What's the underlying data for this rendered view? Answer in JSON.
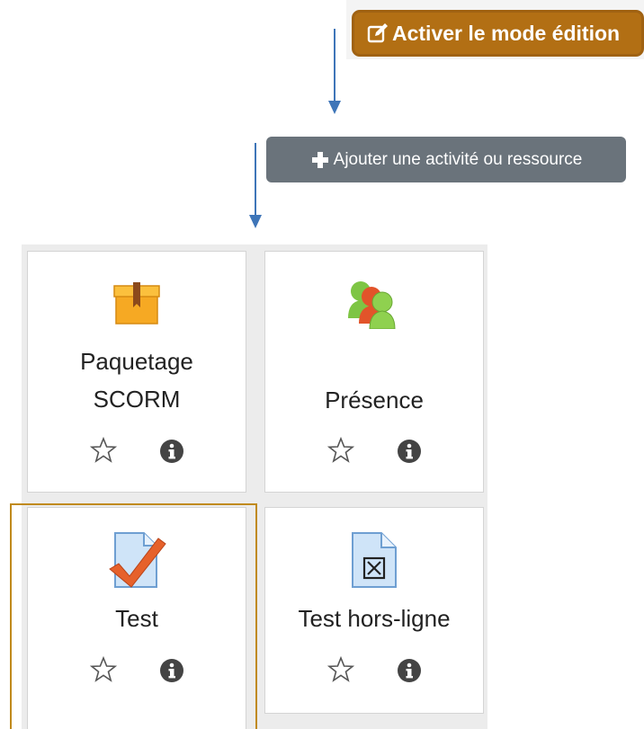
{
  "toolbar": {
    "edit_mode_label": "Activer le mode édition",
    "edit_icon": "edit-icon"
  },
  "add_activity": {
    "label": "Ajouter une activité ou ressource",
    "icon": "plus-icon"
  },
  "activities": [
    {
      "name": "Paquetage\nSCORM",
      "icon": "scorm-package-icon"
    },
    {
      "name": "Présence",
      "icon": "attendance-icon"
    },
    {
      "name": "Test",
      "icon": "quiz-icon"
    },
    {
      "name": "Test hors-ligne",
      "icon": "offline-quiz-icon"
    }
  ],
  "colors": {
    "edit_button": "#b26f14",
    "add_button": "#6a737b",
    "arrow": "#3e75b8",
    "highlight": "#c08a1c"
  }
}
